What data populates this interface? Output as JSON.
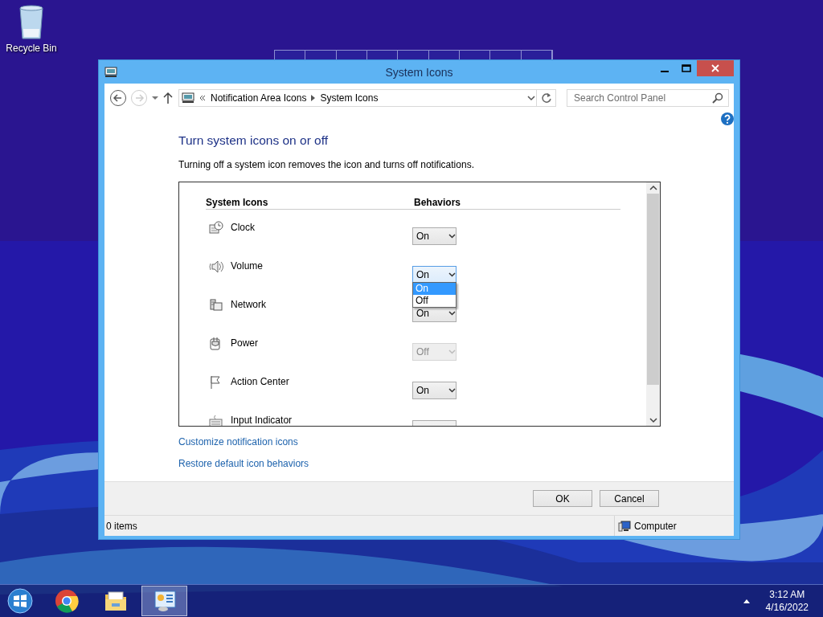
{
  "desktop_icons": [
    {
      "label": "Recycle Bin"
    }
  ],
  "window": {
    "title": "System Icons",
    "address": {
      "path": [
        "Notification Area Icons",
        "System Icons"
      ]
    },
    "search": {
      "placeholder": "Search Control Panel"
    },
    "heading": "Turn system icons on or off",
    "description": "Turning off a system icon removes the icon and turns off notifications.",
    "table": {
      "columns": [
        "System Icons",
        "Behaviors"
      ],
      "rows": [
        {
          "name": "Clock",
          "value": "On",
          "disabled": false,
          "expanded": false
        },
        {
          "name": "Volume",
          "value": "On",
          "disabled": false,
          "expanded": true,
          "options": [
            {
              "label": "On",
              "selected": true
            },
            {
              "label": "Off",
              "selected": false
            }
          ]
        },
        {
          "name": "Network",
          "value": "On",
          "disabled": false,
          "expanded": false
        },
        {
          "name": "Power",
          "value": "Off",
          "disabled": true,
          "expanded": false
        },
        {
          "name": "Action Center",
          "value": "On",
          "disabled": false,
          "expanded": false
        },
        {
          "name": "Input Indicator",
          "disabled": false,
          "expanded": false
        }
      ]
    },
    "links": [
      "Customize notification icons",
      "Restore default icon behaviors"
    ],
    "buttons": [
      "OK",
      "Cancel"
    ],
    "status_bar": {
      "items": "0 items",
      "location": "Computer"
    }
  },
  "taskbar": {
    "apps": [
      {
        "kind": "chrome",
        "selected": false
      },
      {
        "kind": "explorer",
        "selected": false
      },
      {
        "kind": "control-panel",
        "selected": true
      }
    ],
    "clock": {
      "time": "3:12 AM",
      "date": "4/16/2022"
    }
  }
}
